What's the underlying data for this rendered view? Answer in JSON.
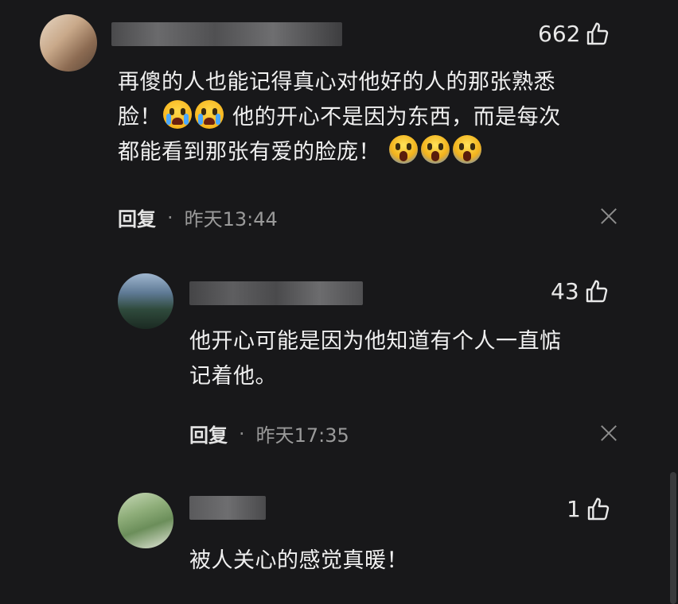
{
  "comments": [
    {
      "likes": "662",
      "text_lines": [
        "再傻的人也能记得真心对他好的人的那张熟悉",
        "脸！",
        "他的开心不是因为东西，而是每次",
        "都能看到那张有爱的脸庞！"
      ],
      "reply_label": "回复",
      "dot": "·",
      "time": "昨天13:44"
    },
    {
      "likes": "43",
      "text_lines": [
        "他开心可能是因为他知道有个人一直惦",
        "记着他。"
      ],
      "reply_label": "回复",
      "dot": "·",
      "time": "昨天17:35"
    },
    {
      "likes": "1",
      "text_lines": [
        "被人关心的感觉真暖！"
      ]
    }
  ],
  "icons": {
    "like": "thumbs-up-icon",
    "close": "close-icon",
    "emoji_cry": "loudly-crying-face-emoji",
    "emoji_scream": "face-screaming-emoji"
  }
}
